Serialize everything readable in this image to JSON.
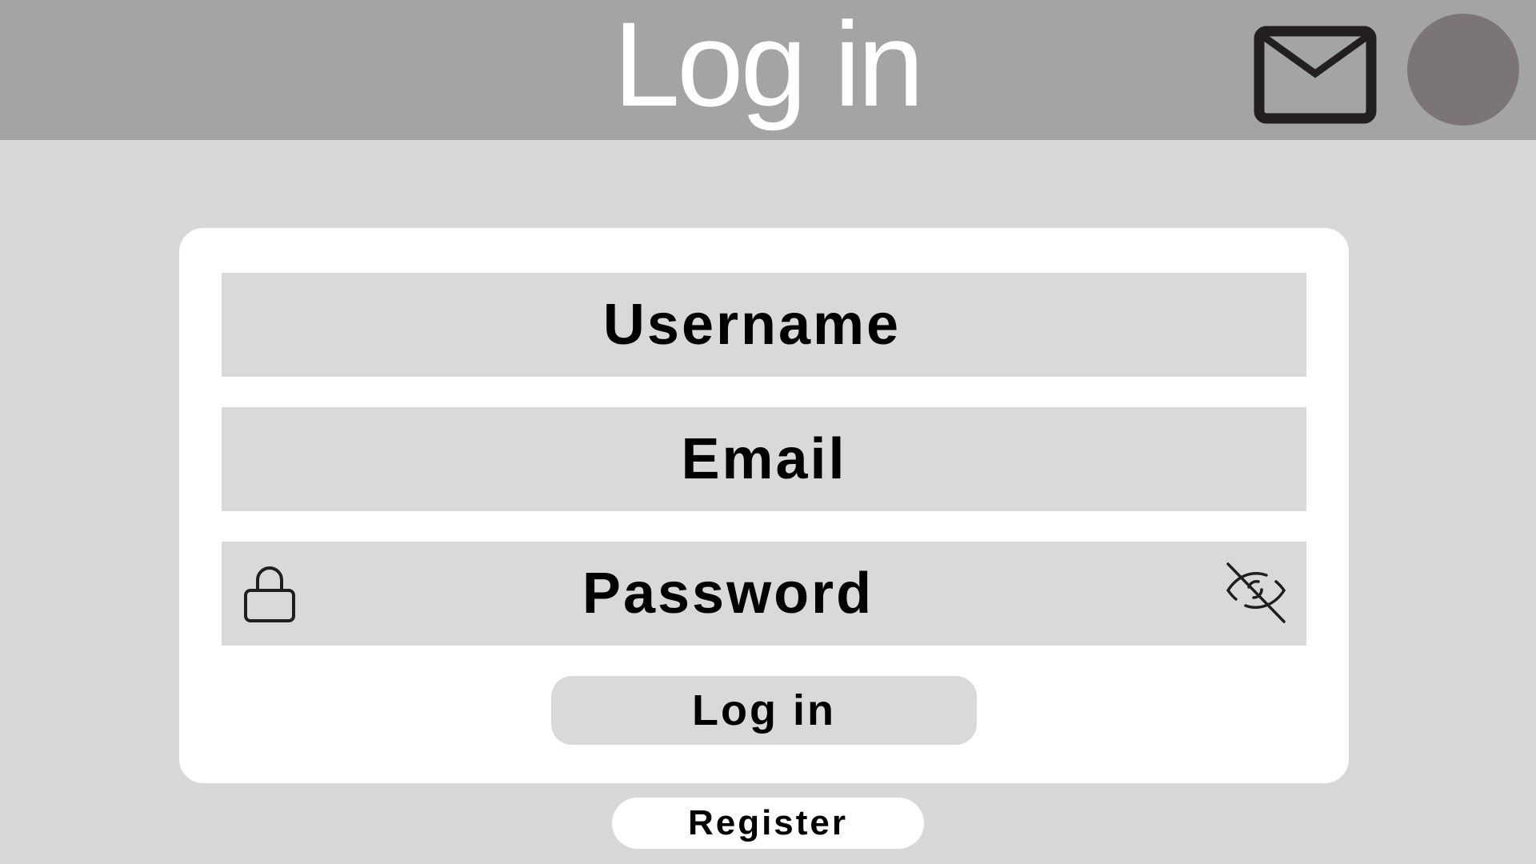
{
  "header": {
    "title": "Log in",
    "mail_icon": "mail-icon",
    "avatar_icon": "avatar",
    "background_color": "#a4a4a4"
  },
  "form": {
    "username_placeholder": "Username",
    "email_placeholder": "Email",
    "password_placeholder": "Password",
    "password_lock_icon": "lock-icon",
    "password_visibility_icon": "eye-off-icon",
    "login_button_label": "Log in",
    "card_color": "#ffffff",
    "field_color": "#d9d9d9"
  },
  "footer": {
    "register_button_label": "Register"
  },
  "colors": {
    "page_background": "#d8d8d8",
    "avatar": "#7b7675"
  }
}
